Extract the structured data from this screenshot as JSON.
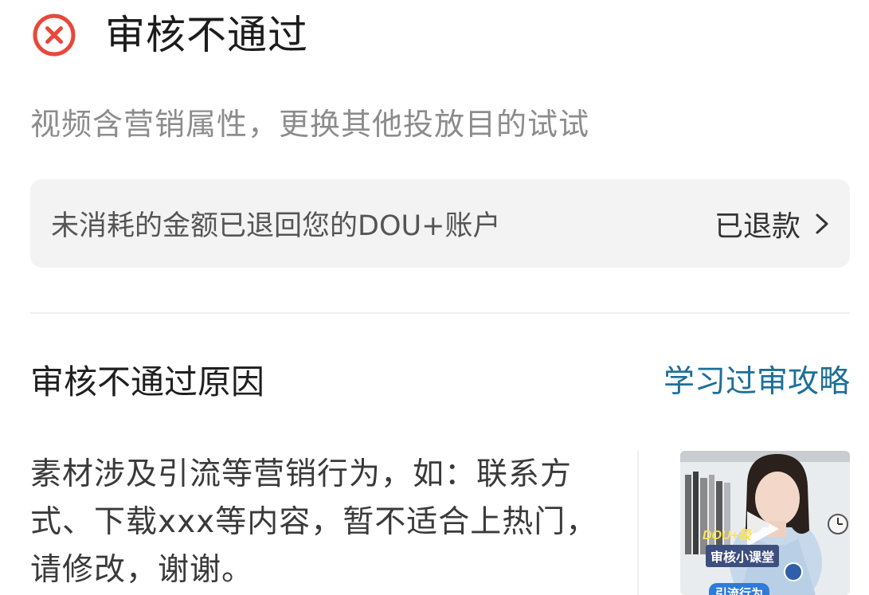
{
  "review": {
    "status_icon": "close-circle-icon",
    "status_color": "#e8483a",
    "title": "审核不通过",
    "subtitle": "视频含营销属性，更换其他投放目的试试"
  },
  "refund": {
    "message": "未消耗的金额已退回您的DOU+账户",
    "status": "已退款",
    "chevron_icon": "chevron-right-icon"
  },
  "reason": {
    "title": "审核不通过原因",
    "guide_link": "学习过审攻略",
    "link_color": "#1d6f9a",
    "description": "素材涉及引流等营销行为，如：联系方式、下载xxx等内容，暂不适合上热门，请修改，谢谢。"
  },
  "video_thumbnail": {
    "brand_label": "DOU+极",
    "main_label": "审核小课堂",
    "sub_label": "引流行为",
    "play_icon": "play-icon"
  }
}
